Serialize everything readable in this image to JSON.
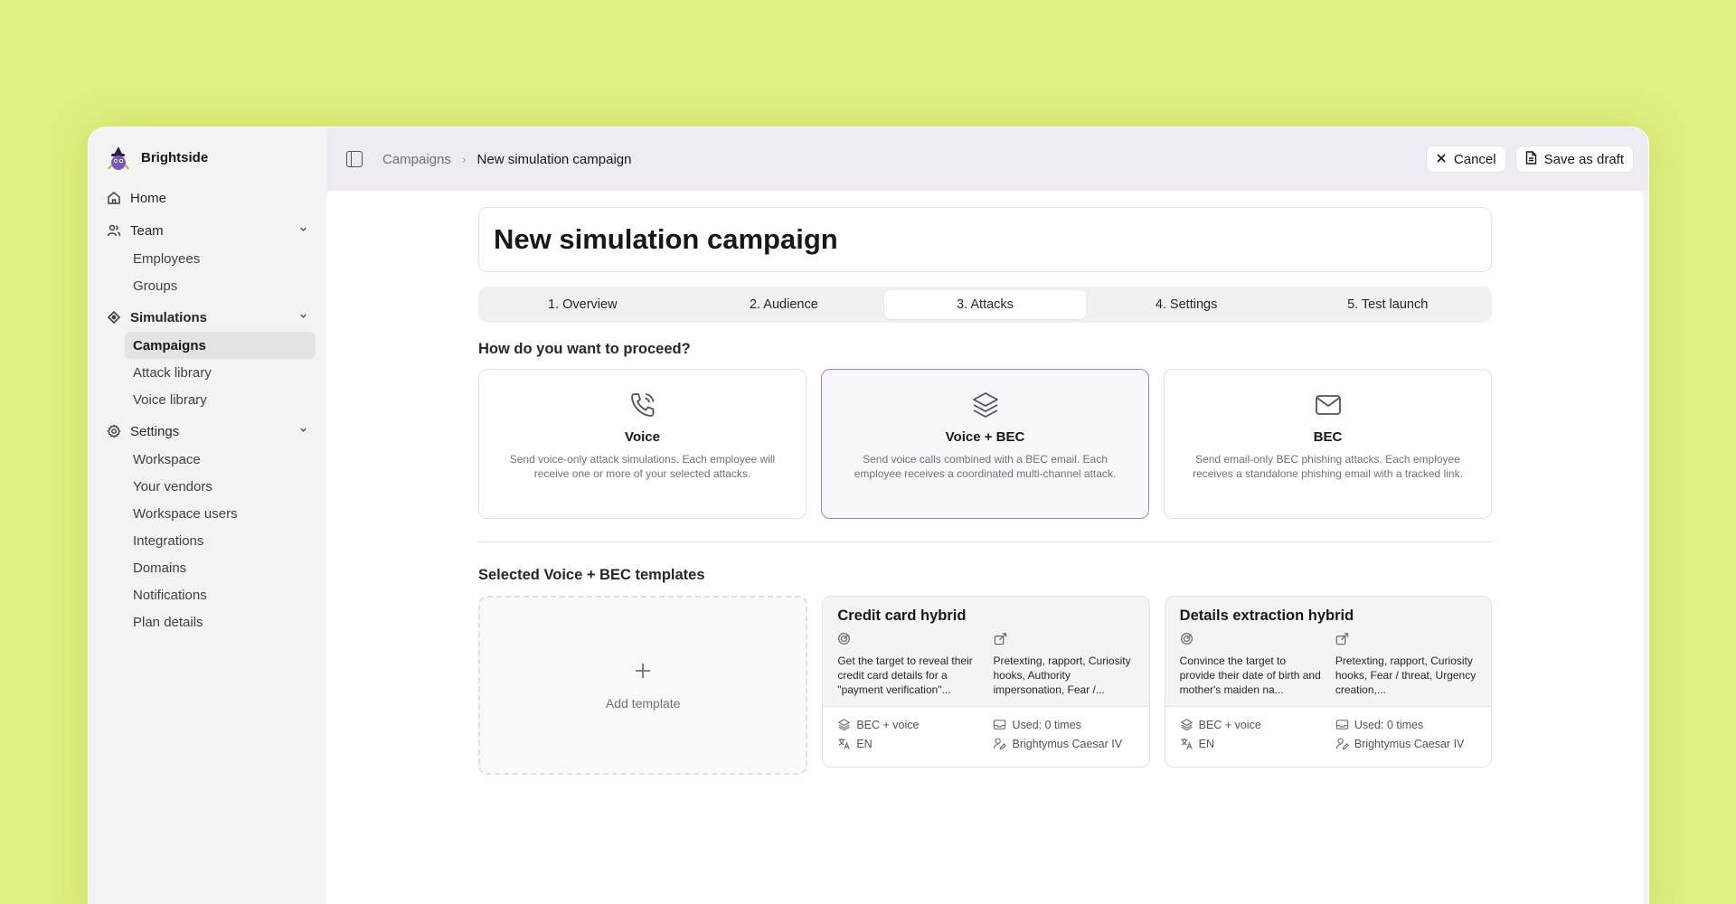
{
  "sidebar": {
    "brand_name": "Brightside",
    "brand_icon": "wizard-mascot-logo",
    "items": {
      "home": "Home",
      "team": "Team",
      "team_sub": [
        "Employees",
        "Groups"
      ],
      "simulations": "Simulations",
      "simulations_sub": [
        "Campaigns",
        "Attack library",
        "Voice library"
      ],
      "settings": "Settings",
      "settings_sub": [
        "Workspace",
        "Your vendors",
        "Workspace users",
        "Integrations",
        "Domains",
        "Notifications",
        "Plan details"
      ]
    },
    "active_item": "Campaigns"
  },
  "topbar": {
    "breadcrumb_parent": "Campaigns",
    "breadcrumb_separator": "›",
    "breadcrumb_current": "New simulation campaign",
    "cancel_label": "Cancel",
    "save_draft_label": "Save as draft"
  },
  "main": {
    "title": "New simulation campaign",
    "steps": [
      "1. Overview",
      "2. Audience",
      "3. Attacks",
      "4. Settings",
      "5. Test launch"
    ],
    "active_step": "3. Attacks",
    "proceed_heading": "How do you want to proceed?",
    "options": [
      {
        "icon": "phone-icon",
        "title": "Voice",
        "description": "Send voice-only attack simulations. Each employee will receive one or more of your selected attacks."
      },
      {
        "icon": "layers-icon",
        "title": "Voice + BEC",
        "description": "Send voice calls combined with a BEC email. Each employee receives a coordinated multi-channel attack."
      },
      {
        "icon": "mail-icon",
        "title": "BEC",
        "description": "Send email-only BEC phishing attacks. Each employee receives a standalone phishing email with a tracked link."
      }
    ],
    "selected_option": "Voice + BEC",
    "templates_heading": "Selected Voice + BEC templates",
    "add_template_label": "Add template",
    "templates": [
      {
        "title": "Credit card hybrid",
        "goal": "Get the target to reveal their credit card details for a \"payment verification\"...",
        "tactics": "Pretexting, rapport, Curiosity hooks, Authority impersonation, Fear /...",
        "type": "BEC + voice",
        "language": "EN",
        "usage": "Used: 0 times",
        "author": "Brightymus Caesar IV"
      },
      {
        "title": "Details extraction hybrid",
        "goal": "Convince the target to provide their date of birth and mother's maiden na...",
        "tactics": "Pretexting, rapport, Curiosity hooks, Fear / threat, Urgency creation,...",
        "type": "BEC + voice",
        "language": "EN",
        "usage": "Used: 0 times",
        "author": "Brightymus Caesar IV"
      }
    ]
  },
  "colors": {
    "background": "#e1ee82",
    "selected_border": "#9e84c4",
    "topbar": "#efeaf3"
  }
}
